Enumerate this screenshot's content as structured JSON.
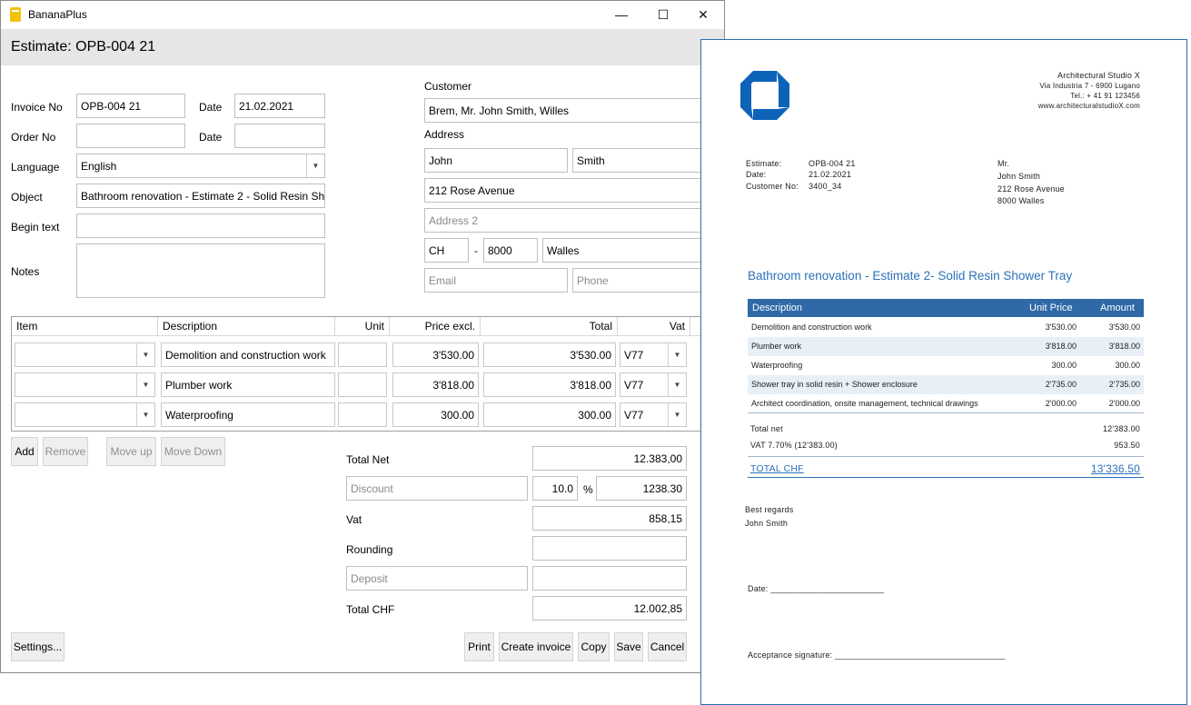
{
  "window": {
    "app_title": "BananaPlus",
    "header_title": "Estimate: OPB-004 21",
    "minimize_glyph": "—",
    "maximize_glyph": "☐",
    "close_glyph": "✕"
  },
  "form": {
    "invoice_no_label": "Invoice No",
    "invoice_no": "OPB-004 21",
    "date_label": "Date",
    "date": "21.02.2021",
    "order_no_label": "Order No",
    "order_no": "",
    "date2_label": "Date",
    "date2": "",
    "language_label": "Language",
    "language": "English",
    "object_label": "Object",
    "object": "Bathroom renovation  - Estimate 2 - Solid Resin Shower Tray",
    "begin_text_label": "Begin text",
    "begin_text": "",
    "notes_label": "Notes",
    "notes": ""
  },
  "customer": {
    "customer_label": "Customer",
    "customer": "Brem, Mr. John Smith, Willes",
    "address_label": "Address",
    "first_name": "John",
    "last_name": "Smith",
    "address1": "212 Rose Avenue",
    "address2_placeholder": "Address 2",
    "country": "CH",
    "dash": "-",
    "zip": "8000",
    "city": "Walles",
    "email_placeholder": "Email",
    "phone_placeholder": "Phone"
  },
  "items_table": {
    "headers": [
      "Item",
      "Description",
      "Unit",
      "Price excl.",
      "Total",
      "Vat"
    ],
    "rows": [
      {
        "item": "",
        "description": "Demolition and construction work",
        "unit": "",
        "price": "3'530.00",
        "total": "3'530.00",
        "vat": "V77"
      },
      {
        "item": "",
        "description": "Plumber work",
        "unit": "",
        "price": "3'818.00",
        "total": "3'818.00",
        "vat": "V77"
      },
      {
        "item": "",
        "description": "Waterproofing",
        "unit": "",
        "price": "300.00",
        "total": "300.00",
        "vat": "V77"
      }
    ]
  },
  "row_buttons": {
    "add": "Add",
    "remove": "Remove",
    "move_up": "Move up",
    "move_down": "Move Down"
  },
  "totals": {
    "total_net_label": "Total Net",
    "total_net": "12.383,00",
    "discount_placeholder": "Discount",
    "discount_pct": "10.0",
    "pct_sign": "%",
    "discount_amount": "1238.30",
    "vat_label": "Vat",
    "vat": "858,15",
    "rounding_label": "Rounding",
    "rounding": "",
    "deposit_placeholder": "Deposit",
    "deposit": "",
    "total_chf_label": "Total  CHF",
    "total_chf": "12.002,85"
  },
  "footer_buttons": {
    "settings": "Settings...",
    "print": "Print",
    "create_invoice": "Create invoice",
    "copy": "Copy",
    "save": "Save",
    "cancel": "Cancel"
  },
  "document": {
    "company": [
      "Architectural Studio X",
      "Via Industria 7 - 6900 Lugano",
      "Tel.: + 41 91 123456",
      "www.architecturalstudioX.com"
    ],
    "meta_labels": [
      "Estimate:",
      "Date:",
      "Customer No:"
    ],
    "meta_values": [
      "OPB-004 21",
      "21.02.2021",
      "3400_34"
    ],
    "recipient": [
      "Mr.",
      "John Smith",
      "212 Rose Avenue",
      "8000 Walles"
    ],
    "title": "Bathroom renovation - Estimate 2- Solid Resin Shower Tray",
    "table_headers": {
      "description": "Description",
      "unit_price": "Unit Price",
      "amount": "Amount"
    },
    "rows": [
      {
        "description": "Demolition and construction work",
        "unit_price": "3'530.00",
        "amount": "3'530.00"
      },
      {
        "description": "Plumber work",
        "unit_price": "3'818.00",
        "amount": "3'818.00"
      },
      {
        "description": "Waterproofing",
        "unit_price": "300.00",
        "amount": "300.00"
      },
      {
        "description": "Shower tray in solid resin + Shower enclosure",
        "unit_price": "2'735.00",
        "amount": "2'735.00"
      },
      {
        "description": "Architect coordination, onsite management, technical drawings",
        "unit_price": "2'000.00",
        "amount": "2'000.00"
      }
    ],
    "total_net_label": "Total net",
    "total_net": "12'383.00",
    "vat_label": "VAT 7.70% (12'383.00)",
    "vat": "953.50",
    "total_label": "TOTAL CHF",
    "total": "13'336.50",
    "regards": "Best regards",
    "signer": "John Smith",
    "date_line": "Date: ________________________",
    "acceptance_line": "Acceptance signature: ____________________________________",
    "brand_color": "#0d63b8",
    "accent_color": "#2c71b8"
  }
}
